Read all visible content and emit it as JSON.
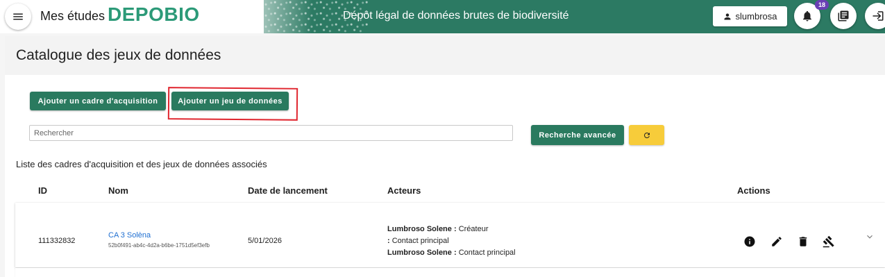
{
  "header": {
    "app_label": "Mes études",
    "logo_text": "DEPOBIO",
    "title": "Dépôt légal de données brutes de biodiversité",
    "user_name": "slumbrosa",
    "notification_count": "18",
    "icons": [
      "menu-icon",
      "person-icon",
      "bell-icon",
      "library-books-icon",
      "logout-icon"
    ]
  },
  "page": {
    "title": "Catalogue des jeux de données",
    "buttons": {
      "add_framework": "Ajouter un cadre d'acquisition",
      "add_dataset": "Ajouter un jeu de données",
      "advanced_search": "Recherche avancée"
    },
    "search_placeholder": "Rechercher",
    "list_caption": "Liste des cadres d'acquisition et des jeux de données associés"
  },
  "table": {
    "columns": [
      "ID",
      "Nom",
      "Date de lancement",
      "Acteurs",
      "Actions"
    ],
    "rows": [
      {
        "id": "111332832",
        "name": "CA 3 Solèna",
        "uuid": "52b0f491-ab4c-4d2a-b6be-1751d5ef3efb",
        "date": "5/01/2026",
        "actors": [
          {
            "name": "Lumbroso Solene",
            "sep": " : ",
            "role": "Créateur"
          },
          {
            "name": "",
            "sep": ": ",
            "role": "Contact principal"
          },
          {
            "name": "Lumbroso Solene",
            "sep": " : ",
            "role": "Contact principal"
          }
        ],
        "actions": [
          "info-icon",
          "edit-icon",
          "delete-icon",
          "gavel-icon"
        ]
      }
    ]
  },
  "colors": {
    "brand_green": "#2c7a63",
    "button_green": "#2a7a5f",
    "accent_yellow": "#f7cc3a",
    "highlight_red": "#e0262f",
    "link_blue": "#1f6fd1",
    "badge_purple": "#6a3fb5"
  }
}
